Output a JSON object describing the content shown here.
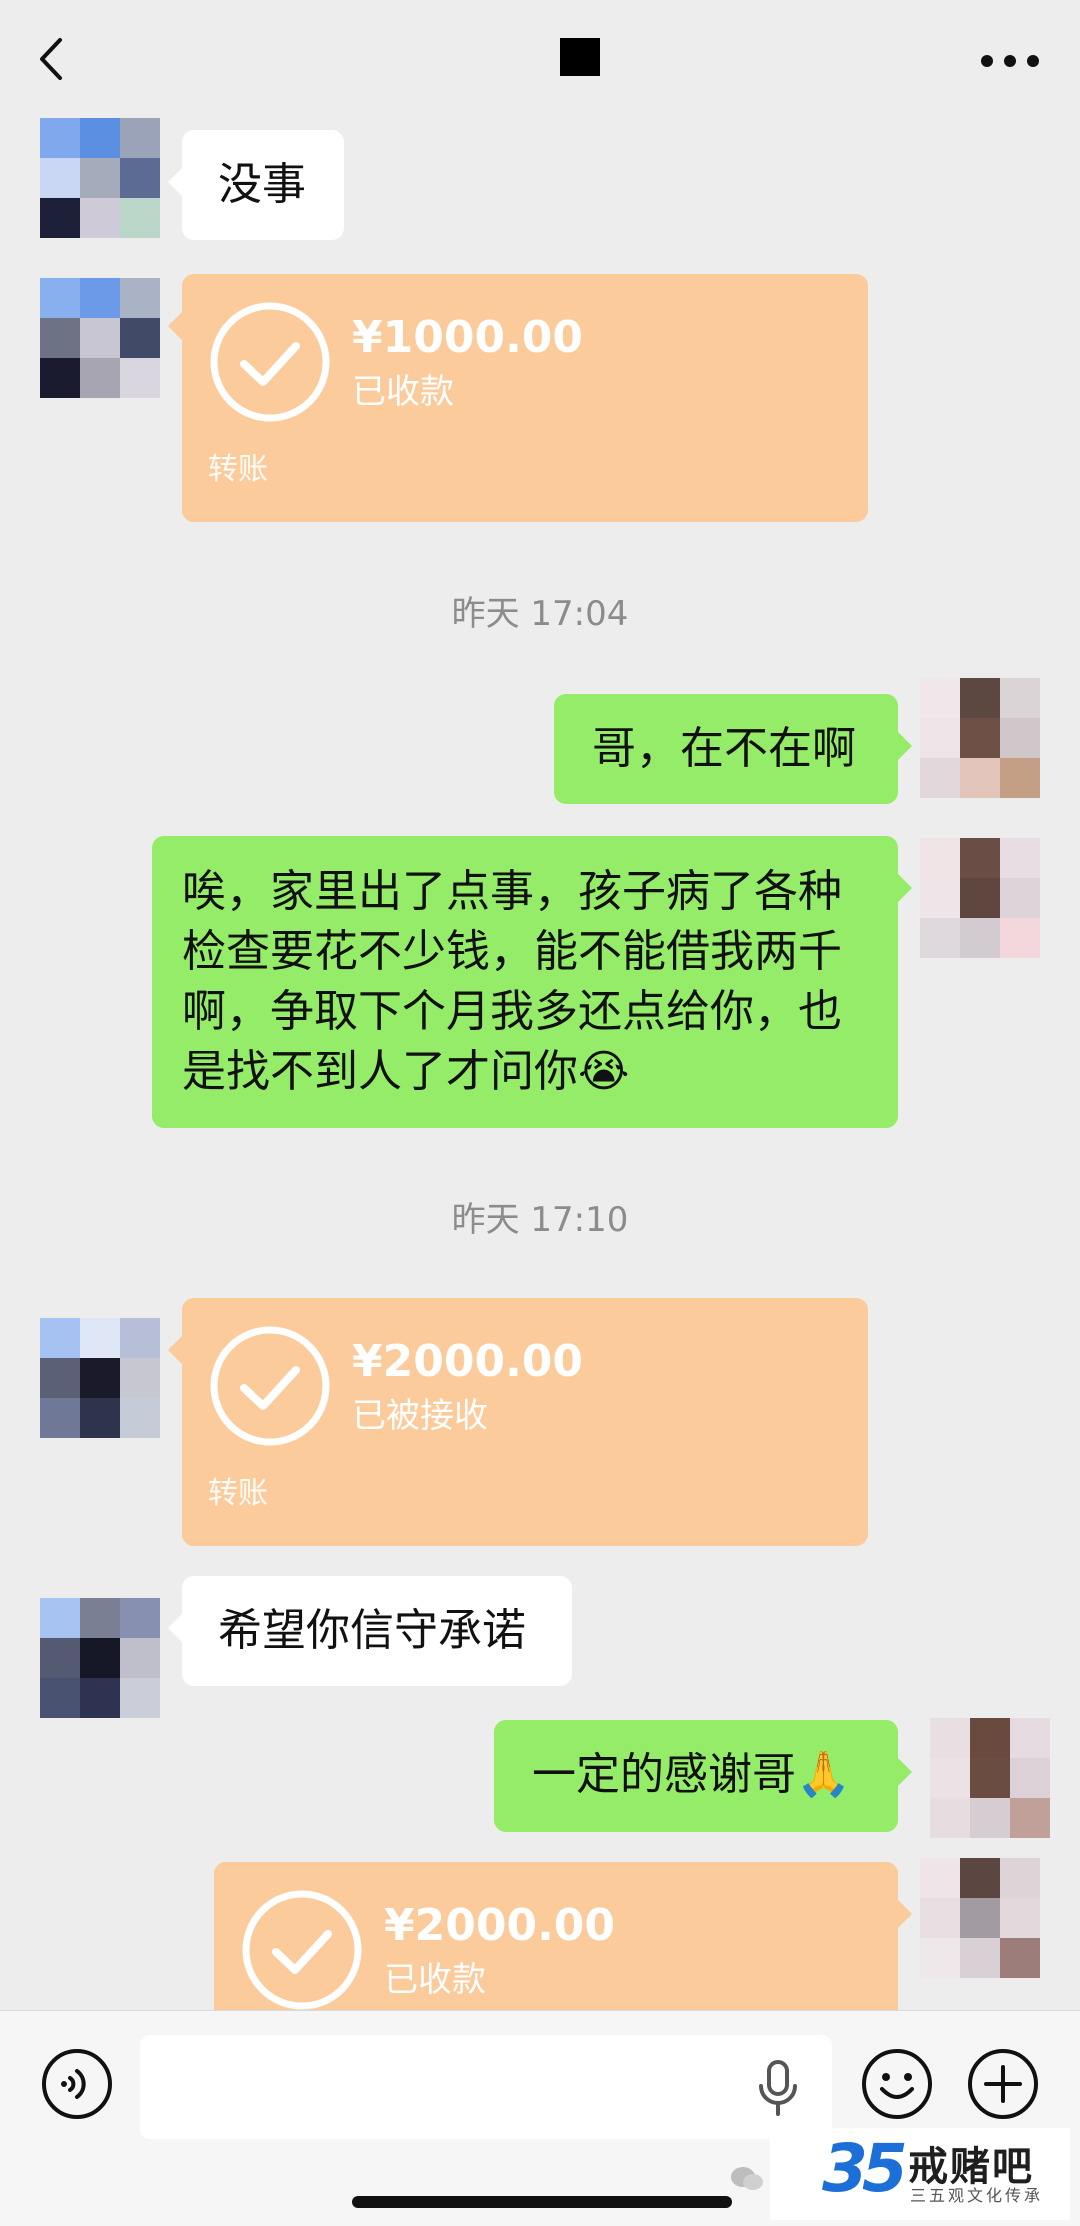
{
  "header": {
    "title_blocked": true
  },
  "messages": [
    {
      "side": "left",
      "kind": "text",
      "text": "没事"
    },
    {
      "side": "left",
      "kind": "transfer",
      "amount": "¥1000.00",
      "status": "已收款",
      "type": "转账"
    },
    {
      "kind": "timestamp",
      "text": "昨天 17:04"
    },
    {
      "side": "right",
      "kind": "text",
      "text": "哥，在不在啊"
    },
    {
      "side": "right",
      "kind": "text",
      "lines": [
        "唉，家里出了点事，孩子病了各种",
        "检查要花不少钱，能不能借我两千",
        "啊，争取下个月我多还点给你，也",
        "是找不到人了才问你😭"
      ]
    },
    {
      "kind": "timestamp",
      "text": "昨天 17:10"
    },
    {
      "side": "left",
      "kind": "transfer",
      "amount": "¥2000.00",
      "status": "已被接收",
      "type": "转账"
    },
    {
      "side": "left",
      "kind": "text",
      "text": "希望你信守承诺"
    },
    {
      "side": "right",
      "kind": "text",
      "text": "一定的感谢哥🙏"
    },
    {
      "side": "right",
      "kind": "transfer",
      "amount": "¥2000.00",
      "status": "已收款"
    }
  ],
  "input": {
    "value": "",
    "placeholder": ""
  },
  "watermark": {
    "name": "戒赌吧",
    "sub": "三五观文化传承",
    "logo_text": "35"
  },
  "colors": {
    "background": "#ededed",
    "bubble_green": "#95ec69",
    "bubble_white": "#ffffff",
    "transfer_orange": "#fbcb9b",
    "timestamp": "#8c8c8c"
  },
  "icons": [
    "back-icon",
    "more-icon",
    "check-circle-icon",
    "voice-icon",
    "microphone-icon",
    "emoji-icon",
    "plus-icon"
  ]
}
